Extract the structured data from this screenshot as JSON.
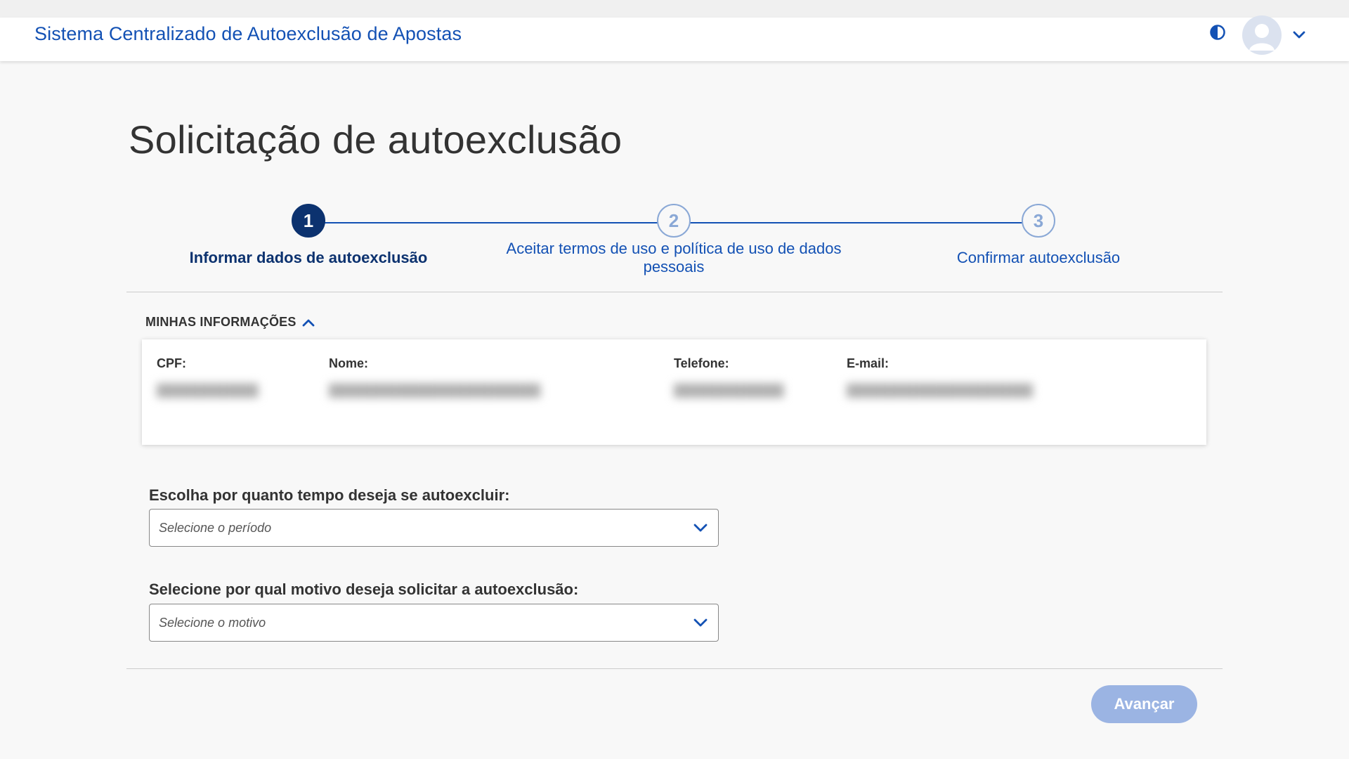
{
  "header": {
    "title": "Sistema Centralizado de Autoexclusão de Apostas",
    "contrast_icon": "contrast-icon",
    "avatar_icon": "user-avatar-icon",
    "menu_icon": "chevron-down-icon"
  },
  "page": {
    "title": "Solicitação de autoexclusão"
  },
  "stepper": {
    "steps": [
      {
        "number": "1",
        "label": "Informar dados de autoexclusão",
        "state": "active"
      },
      {
        "number": "2",
        "label": "Aceitar termos de uso e política de uso de dados pessoais",
        "state": "pending"
      },
      {
        "number": "3",
        "label": "Confirmar autoexclusão",
        "state": "pending"
      }
    ]
  },
  "my_info": {
    "section_label": "MINHAS INFORMAÇÕES",
    "fields": {
      "cpf_label": "CPF:",
      "name_label": "Nome:",
      "phone_label": "Telefone:",
      "email_label": "E-mail:"
    },
    "values_blurred": true
  },
  "form": {
    "period": {
      "label": "Escolha por quanto tempo deseja se autoexcluir:",
      "placeholder": "Selecione o período"
    },
    "reason": {
      "label": "Selecione por qual motivo deseja solicitar a autoexclusão:",
      "placeholder": "Selecione o motivo"
    }
  },
  "actions": {
    "next_label": "Avançar"
  },
  "colors": {
    "primary": "#1351b4",
    "primary_dark": "#0c326f",
    "disabled_button": "#9bb4e3",
    "step_pending": "#8aa8d6",
    "background": "#f8f8f8"
  }
}
